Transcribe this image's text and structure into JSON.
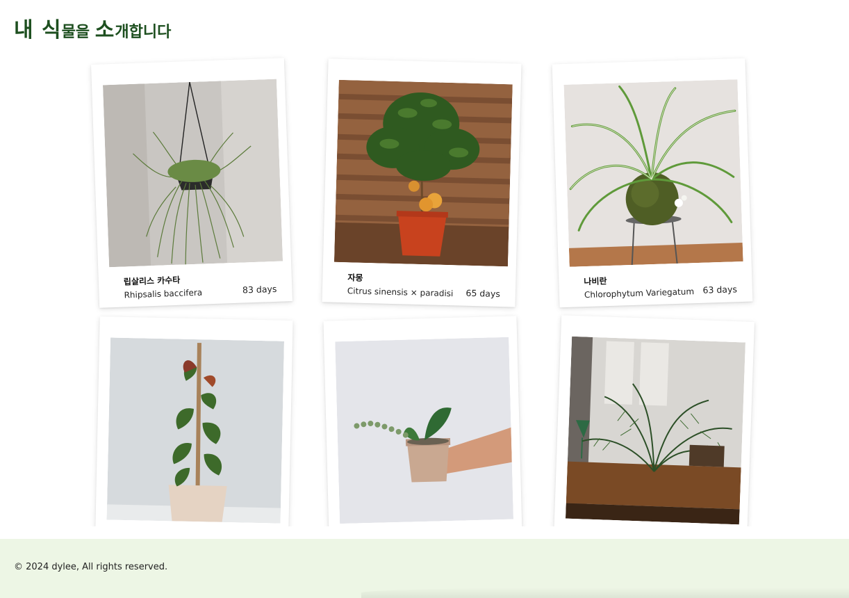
{
  "header": {
    "title_part1": "내 식",
    "title_part2": "물을 ",
    "title_part3": "소",
    "title_part4": "개합니다"
  },
  "plants": [
    {
      "korean_name": "립살리스 카수타",
      "latin_name": "Rhipsalis baccifera",
      "days": "83 days"
    },
    {
      "korean_name": "자몽",
      "latin_name": "Citrus sinensis × paradisi",
      "days": "65 days"
    },
    {
      "korean_name": "나비란",
      "latin_name": "Chlorophytum Variegatum",
      "days": "63 days"
    },
    {
      "korean_name": "",
      "latin_name": "",
      "days": ""
    },
    {
      "korean_name": "",
      "latin_name": "",
      "days": ""
    },
    {
      "korean_name": "",
      "latin_name": "",
      "days": ""
    }
  ],
  "footer": {
    "copyright": "© 2024 dylee, All rights reserved."
  }
}
